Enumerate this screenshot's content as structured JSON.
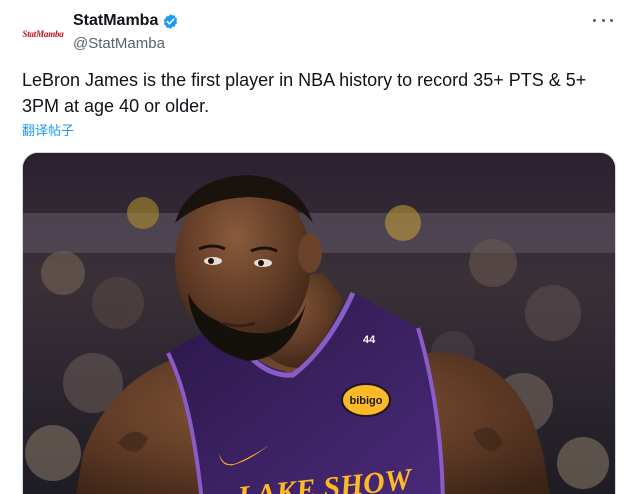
{
  "author": {
    "avatar_text": "StatMamba",
    "display_name": "StatMamba",
    "handle": "@StatMamba",
    "verified": true
  },
  "tweet": {
    "text": "LeBron James is the first player in NBA history to record 35+ PTS & 5+ 3PM at age 40 or older.",
    "translate_label": "翻译帖子"
  },
  "media": {
    "jersey_number": "44",
    "sponsor_patch": "bibigo",
    "jersey_wordmark": "LAKE SHOW"
  },
  "colors": {
    "verified": "#1d9bf0",
    "link": "#1d9bf0",
    "jersey_purple": "#3b1f63",
    "jersey_trim": "#8a5cc8",
    "gold": "#fdb927"
  }
}
